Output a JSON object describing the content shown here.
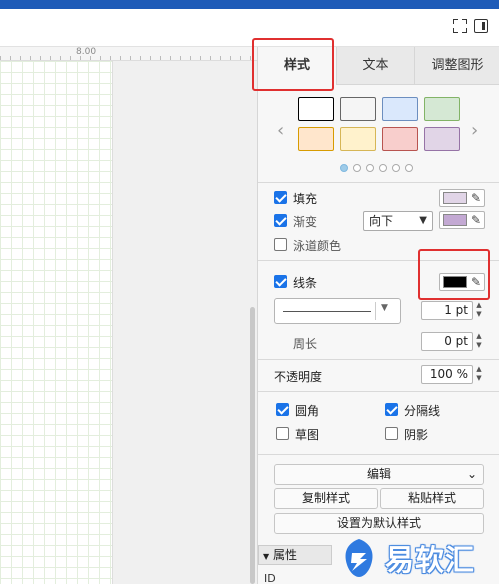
{
  "window": {
    "accent_color": "#1e5bb8"
  },
  "toolbar": {
    "icons": [
      "fullscreen-icon",
      "panel-toggle-icon"
    ]
  },
  "canvas": {
    "ruler_label": "8.00"
  },
  "tabs": [
    {
      "label": "样式",
      "active": true
    },
    {
      "label": "文本",
      "active": false
    },
    {
      "label": "调整图形",
      "active": false
    }
  ],
  "style_swatches": {
    "row1": [
      {
        "fill": "#ffffff",
        "stroke": "#000000"
      },
      {
        "fill": "#f5f5f5",
        "stroke": "#666666"
      },
      {
        "fill": "#dae8fc",
        "stroke": "#6c8ebf"
      },
      {
        "fill": "#d5e8d4",
        "stroke": "#82b366"
      }
    ],
    "row2": [
      {
        "fill": "#ffe6cc",
        "stroke": "#d79b00"
      },
      {
        "fill": "#fff2cc",
        "stroke": "#d6b656"
      },
      {
        "fill": "#f8cecc",
        "stroke": "#b85450"
      },
      {
        "fill": "#e1d5e7",
        "stroke": "#9673a6"
      }
    ],
    "page_dots": 6,
    "active_dot": 0
  },
  "fill": {
    "fill_label": "填充",
    "fill_checked": true,
    "fill_color": "#e1d5e7",
    "gradient_label": "渐变",
    "gradient_checked": true,
    "gradient_direction": "向下",
    "gradient_color": "#c3a9d3",
    "swimlane_label": "泳道颜色",
    "swimlane_checked": false
  },
  "line": {
    "line_label": "线条",
    "line_checked": true,
    "line_color": "#000000",
    "width_value": "1 pt",
    "perimeter_label": "周长",
    "perimeter_value": "0 pt"
  },
  "opacity": {
    "label": "不透明度",
    "value": "100 %"
  },
  "options": {
    "rounded_label": "圆角",
    "rounded_checked": true,
    "separator_label": "分隔线",
    "separator_checked": true,
    "sketch_label": "草图",
    "sketch_checked": false,
    "shadow_label": "阴影",
    "shadow_checked": false
  },
  "actions": {
    "edit_label": "编辑",
    "copy_style_label": "复制样式",
    "paste_style_label": "粘贴样式",
    "set_default_label": "设置为默认样式"
  },
  "properties": {
    "header": "属性",
    "id_label": "ID"
  },
  "watermark": {
    "text": "易软汇"
  }
}
